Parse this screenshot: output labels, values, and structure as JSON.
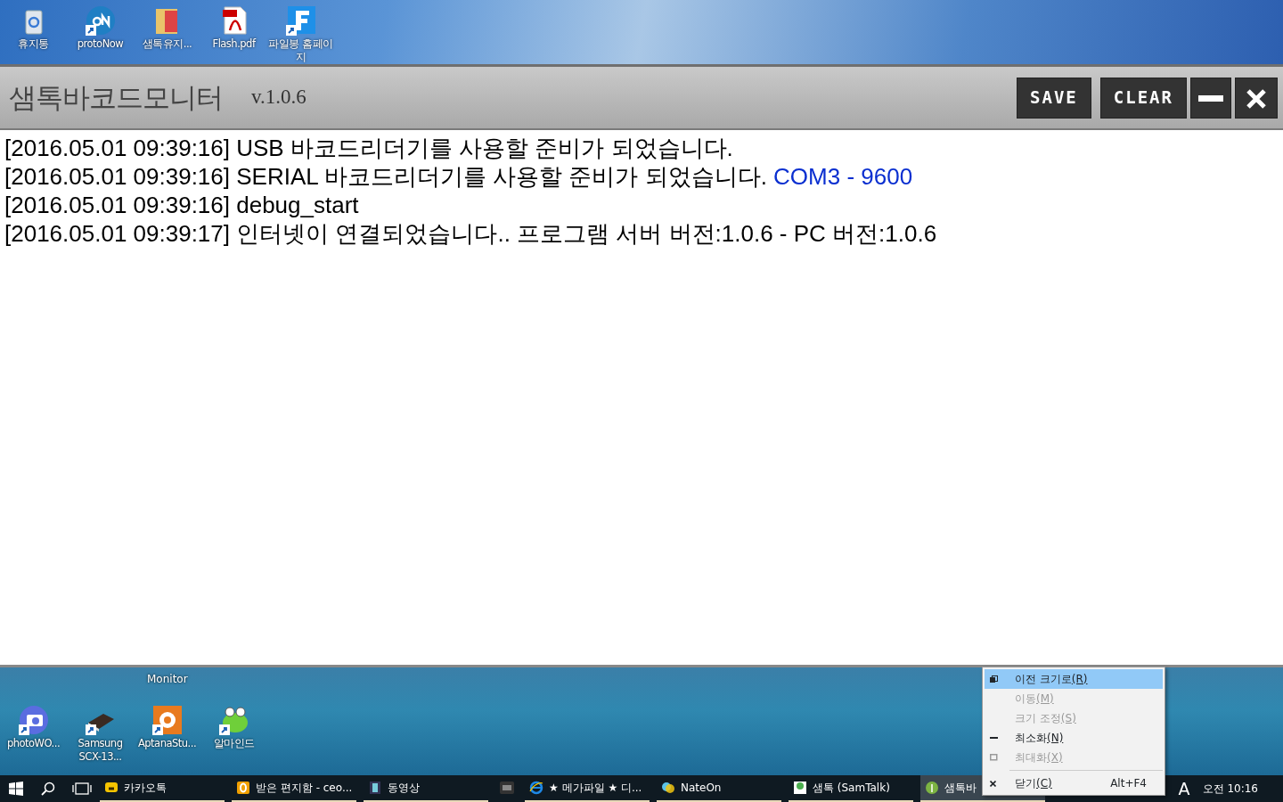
{
  "desktop_top": {
    "icons": [
      {
        "label": "휴지통",
        "kind": "recycle",
        "shortcut": false
      },
      {
        "label": "protoNow",
        "kind": "proto",
        "shortcut": true
      },
      {
        "label": "샘톡유지...",
        "kind": "folder",
        "shortcut": false
      },
      {
        "label": "Flash.pdf",
        "kind": "pdf",
        "shortcut": false
      },
      {
        "label": "파일봉 홈페이지",
        "kind": "letter",
        "shortcut": true
      }
    ]
  },
  "window": {
    "title": "샘톡바코드모니터",
    "version": "v.1.0.6",
    "buttons": [
      {
        "label": "SAVE",
        "kind": "text"
      },
      {
        "label": "CLEAR",
        "kind": "text"
      },
      {
        "kind": "minimize"
      },
      {
        "kind": "close"
      }
    ]
  },
  "log": [
    {
      "text": "[2016.05.01 09:39:16] USB 바코드리더기를 사용할 준비가 되었습니다."
    },
    {
      "text": "[2016.05.01 09:39:16] SERIAL 바코드리더기를 사용할 준비가 되었습니다. ",
      "port": "COM3 - 9600"
    },
    {
      "text": "[2016.05.01 09:39:16] debug_start"
    },
    {
      "text": "[2016.05.01 09:39:17] 인터넷이 연결되었습니다.. 프로그램 서버 버전:1.0.6 - PC 버전:1.0.6"
    }
  ],
  "desktop_bottom": {
    "caption": "Monitor",
    "icons": [
      {
        "label": "photoWO...",
        "kind": "camera",
        "shortcut": true
      },
      {
        "label": "Samsung SCX-13...",
        "kind": "printer",
        "shortcut": true
      },
      {
        "label": "AptanaStu...",
        "kind": "gear",
        "shortcut": true
      },
      {
        "label": "알마인드",
        "kind": "frog",
        "shortcut": true
      }
    ]
  },
  "context_menu": {
    "items": [
      {
        "label": "이전 크기로",
        "accel": "(R)",
        "kind": "restore",
        "disabled": false,
        "selected": true
      },
      {
        "label": "이동",
        "accel": "(M)",
        "disabled": true,
        "selected": false
      },
      {
        "label": "크기 조정",
        "accel": "(S)",
        "disabled": true,
        "selected": false
      },
      {
        "label": "최소화",
        "accel": "(N)",
        "kind": "minimize",
        "disabled": false,
        "selected": false
      },
      {
        "label": "최대화",
        "accel": "(X)",
        "kind": "maximize",
        "disabled": true,
        "selected": false
      },
      {
        "label": "닫기",
        "accel": "(C)",
        "kind": "close",
        "shortcut": "Alt+F4",
        "disabled": false,
        "selected": false,
        "separator_before": true
      }
    ]
  },
  "taskbar": {
    "items": [
      {
        "label": "카카오톡",
        "kind": "kakao",
        "selected": false
      },
      {
        "label": "받은 편지함 - ceo...",
        "kind": "mail",
        "selected": false
      },
      {
        "label": "동영상",
        "kind": "film",
        "selected": false
      },
      {
        "kind": "square",
        "selected": false
      },
      {
        "label": "★ 메가파일 ★ 디...",
        "kind": "browser",
        "selected": false
      },
      {
        "label": "NateOn",
        "kind": "nateon",
        "selected": false
      },
      {
        "label": "샘톡 (SamTalk)",
        "kind": "samtalk",
        "selected": false
      },
      {
        "label": "샘톡바",
        "kind": "bar",
        "selected": true
      }
    ],
    "ime": "A",
    "clock": "오전 10:16"
  }
}
